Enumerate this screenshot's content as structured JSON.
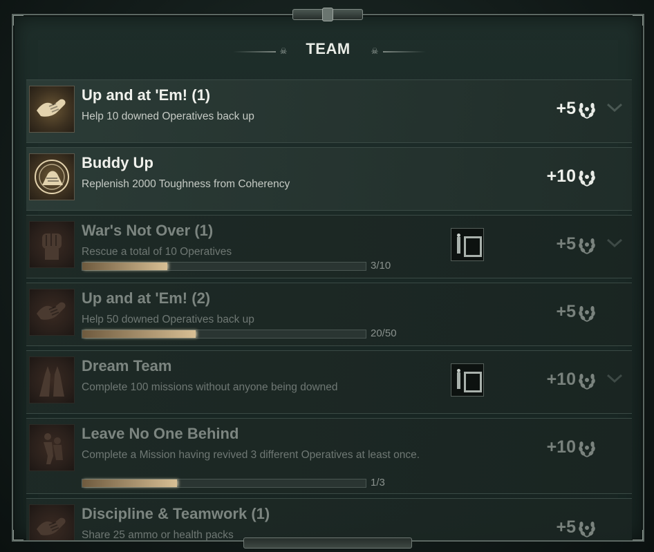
{
  "panel": {
    "title": "TEAM"
  },
  "achievements": [
    {
      "title": "Up and at 'Em! (1)",
      "description": "Help 10 downed Operatives back up",
      "reward": "+5",
      "state": "completed",
      "icon": "helping-hands-icon",
      "has_chevron": true
    },
    {
      "title": "Buddy Up",
      "description": "Replenish 2000 Toughness from Coherency",
      "reward": "+10",
      "state": "completed",
      "icon": "clasped-hands-icon",
      "has_chevron": false
    },
    {
      "title": "War's Not Over (1)",
      "description": "Rescue a total of 10 Operatives",
      "reward": "+5",
      "state": "locked",
      "icon": "fist-icon",
      "progress": 0.3,
      "progress_text": "3/10",
      "has_frame_reward": true,
      "has_chevron": true
    },
    {
      "title": "Up and at 'Em! (2)",
      "description": "Help 50 downed Operatives back up",
      "reward": "+5",
      "state": "locked",
      "icon": "helping-hands-icon",
      "progress": 0.4,
      "progress_text": "20/50",
      "has_chevron": false
    },
    {
      "title": "Dream Team",
      "description": "Complete 100 missions without anyone being downed",
      "reward": "+10",
      "state": "locked",
      "icon": "raised-hands-icon",
      "has_frame_reward": true,
      "has_chevron": true
    },
    {
      "title": "Leave No One Behind",
      "description": "Complete a Mission having revived 3 different Operatives at least once.",
      "reward": "+10",
      "state": "locked",
      "icon": "carry-figure-icon",
      "progress": 0.333,
      "progress_text": "1/3",
      "has_chevron": false
    },
    {
      "title": "Discipline & Teamwork (1)",
      "description": "Share 25 ammo or health packs",
      "reward": "+5",
      "state": "locked",
      "icon": "helping-hands-icon",
      "has_chevron": false
    }
  ],
  "colors": {
    "panel_bg": "#1a2825",
    "progress_fill": "#d8bf94",
    "text_active": "#f0f1ec",
    "text_locked": "#7c8580"
  }
}
